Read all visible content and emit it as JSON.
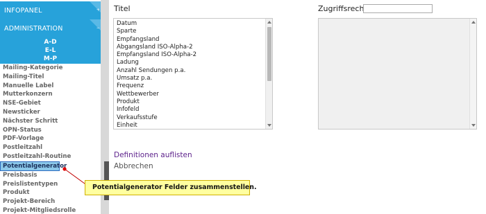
{
  "sidebar": {
    "infopanel_label": "INFOPANEL",
    "admin_label": "ADMINISTRATION",
    "az_items": [
      "A-D",
      "E-L",
      "M-P"
    ],
    "items": [
      "Mailing-Kategorie",
      "Mailing-Titel",
      "Manuelle Label",
      "Mutterkonzern",
      "NSE-Gebiet",
      "Newsticker",
      "Nächster Schritt",
      "OPN-Status",
      "PDF-Vorlage",
      "Postleitzahl",
      "Postleitzahl-Routine",
      "Potentialgenerator",
      "Preisbasis",
      "Preislistentypen",
      "Produkt",
      "Projekt-Bereich",
      "Projekt-Mitgliedsrolle"
    ],
    "active_item": "Potentialgenerator"
  },
  "main": {
    "title_label": "Titel",
    "access_label": "Zugriffsrecht",
    "access_value": "",
    "title_options": [
      "Datum",
      "Sparte",
      "Empfangsland",
      "Abgangsland ISO-Alpha-2",
      "Empfangsland ISO-Alpha-2",
      "Ladung",
      "Anzahl Sendungen p.a.",
      "Umsatz p.a.",
      "Frequenz",
      "Wettbewerber",
      "Produkt",
      "Infofeld",
      "Verkaufsstufe",
      "Einheit"
    ],
    "define_link": "Definitionen auflisten",
    "cancel_link": "Abbrechen"
  },
  "annotation": {
    "text": "Potentialgenerator Felder zusammenstellen."
  },
  "colors": {
    "sidebar_header": "#27a2da",
    "active_item_bg": "#8cc8ea",
    "callout_bg": "#ffffa0",
    "link_purple": "#5b1f8a"
  }
}
